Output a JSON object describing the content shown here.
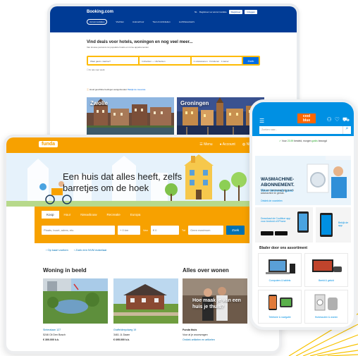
{
  "booking": {
    "logo": "Booking.com",
    "header_links": [
      "NL",
      "Registreer uw accommodatie",
      "Registreer",
      "Inloggen"
    ],
    "nav": [
      "Accommodaties",
      "Vluchten",
      "Autoverhuur",
      "Tours & Activiteiten",
      "Luchthaventaxi's"
    ],
    "title": "Vind deals voor hotels, woningen en nog veel meer...",
    "subtitle": "Van knusse pensions tot populaire hotels en ruime appartementen",
    "search": {
      "destination_placeholder": "Waar gaat u naartoe?",
      "dates_placeholder": "Inchecken — Uitchecken",
      "guests_value": "2 volwassenen · 0 kinderen · 1 kamer",
      "button": "Zoek"
    },
    "checkbox_label": "Ik reis voor werk",
    "notice_text": "Houd geschikte bedingen aangehouden!",
    "notice_link": "Bekijk de nieuwste",
    "cities": [
      "Zwolle",
      "Groningen"
    ]
  },
  "funda": {
    "logo": "funda",
    "menu": [
      "Menu",
      "Account",
      "NL"
    ],
    "slogan": "Een huis dat alles heeft, zelfs barretjes om de hoek",
    "tabs": [
      "Koop",
      "Huur",
      "Nieuwbouw",
      "Recreatie",
      "Europa"
    ],
    "search": {
      "place_placeholder": "Plaats, buurt, adres, etc.",
      "radius": "+ 0 km",
      "price_from_label": "Van",
      "price_from": "€ 0",
      "price_to_label": "Tot",
      "price_to": "Geen maximum",
      "button": "Zoek"
    },
    "links": [
      "Op kaart zoeken",
      "Zoek een NVM makelaar"
    ],
    "woning_title": "Woning in beeld",
    "alles_title": "Alles over wonen",
    "listings": [
      {
        "street": "Sinteralaan 127",
        "city": "5246 Cit Den Bosch",
        "price": "€ 300.000 k.k."
      },
      {
        "street": "Graffelderpolweg 19",
        "city": "3461 JL Daam",
        "price": "€ 695.000 k.k."
      }
    ],
    "news": {
      "quote": "Hoe maak je van een huis je thuis?",
      "source": "Funda thuis",
      "desc": "Voor al je woonvragen",
      "link": "Ontdek artikelen en artikelen"
    }
  },
  "coolblue": {
    "logo_line1": "cool",
    "logo_line2": "blue",
    "search_placeholder": "Zoeken naar...",
    "usp_prefix": "Voor",
    "usp_highlight1": "23.59",
    "usp_mid": "besteld, morgen",
    "usp_highlight2": "gratis",
    "usp_suffix": "bezorgd",
    "banner_title_1": "WASMACHINE-",
    "banner_title_2": "ABONNEMENT.",
    "banner_title_3": "Weer timmeels goed",
    "banner_body": "Voor een vast bedrag krijg je een wasmachine en gemak.",
    "banner_link": "Ontdek de voordelen",
    "app_text": "Download de Coolblue app voor Android of iPhone",
    "app2_text": "Bekijk de app",
    "section_title": "Blader door ons assortiment",
    "categories": [
      "Computers & tablets",
      "Beeld & geluid",
      "Telefonie & navigatie",
      "Huishouden & wonen"
    ]
  },
  "colors": {
    "booking_blue": "#003b95",
    "booking_yellow": "#febb02",
    "funda_orange": "#f7a100",
    "funda_blue": "#0071b3",
    "coolblue_blue": "#0090e3",
    "coolblue_orange": "#ff6600"
  }
}
